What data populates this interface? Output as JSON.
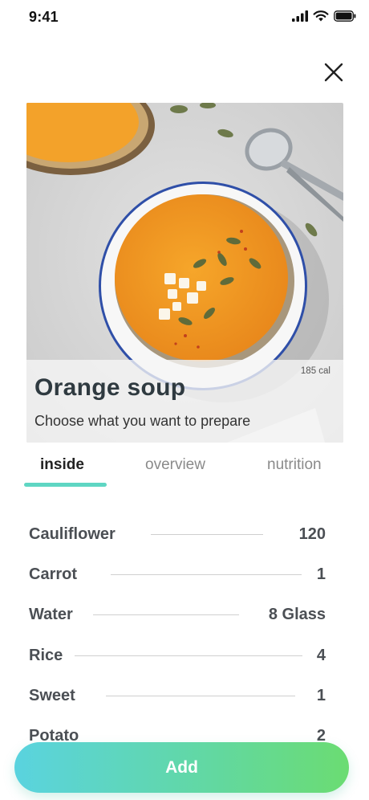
{
  "status": {
    "time": "9:41"
  },
  "recipe": {
    "title": "Orange soup",
    "subtitle": "Choose what you want to prepare",
    "calories": "185 cal"
  },
  "tabs": [
    {
      "label": "inside",
      "active": true
    },
    {
      "label": "overview",
      "active": false
    },
    {
      "label": "nutrition",
      "active": false
    }
  ],
  "ingredients": [
    {
      "name": "Cauliflower",
      "amount": "120"
    },
    {
      "name": "Carrot",
      "amount": "1"
    },
    {
      "name": "Water",
      "amount": "8 Glass"
    },
    {
      "name": "Rice",
      "amount": "4"
    },
    {
      "name": "Sweet",
      "amount": "1"
    },
    {
      "name": "Potato",
      "amount": "2"
    }
  ],
  "actions": {
    "add_label": "Add"
  },
  "colors": {
    "accent": "#5fd6c3",
    "button_start": "#5ad3df",
    "button_end": "#6bdc72"
  }
}
